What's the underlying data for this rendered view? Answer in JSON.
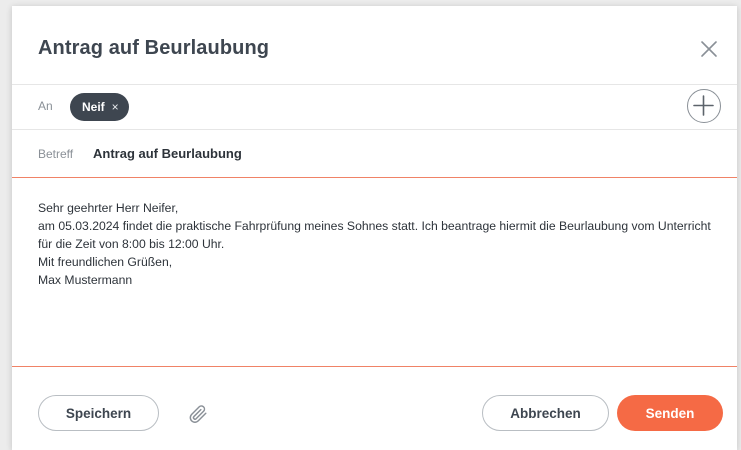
{
  "dialog": {
    "title": "Antrag auf Beurlaubung"
  },
  "recipients": {
    "label": "An",
    "chips": [
      {
        "name": "Neif",
        "remove": "×"
      }
    ]
  },
  "subject": {
    "label": "Betreff",
    "value": "Antrag auf Beurlaubung"
  },
  "message": {
    "lines": [
      "Sehr geehrter Herr Neifer,",
      "am 05.03.2024 findet die praktische Fahrprüfung meines Sohnes statt. Ich beantrage hiermit die Beurlaubung vom Unterricht",
      "für die Zeit von 8:00 bis 12:00 Uhr.",
      "Mit freundlichen Grüßen,",
      "Max Mustermann"
    ]
  },
  "footer": {
    "save_label": "Speichern",
    "cancel_label": "Abbrechen",
    "send_label": "Senden"
  },
  "icons": {
    "close": "close-icon",
    "add": "plus-icon",
    "attach": "paperclip-icon"
  },
  "colors": {
    "accent": "#f56a45",
    "divider_accent": "#f08266",
    "chip_bg": "#3e4650",
    "title": "#3e4650"
  }
}
